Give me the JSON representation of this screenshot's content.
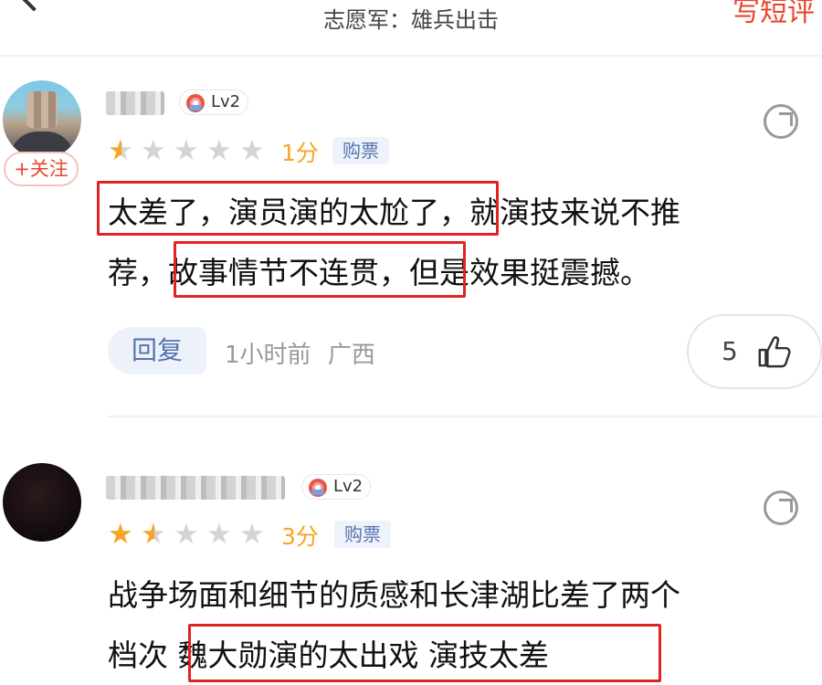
{
  "header": {
    "title": "志愿军：雄兵出击",
    "right_action": "写短评"
  },
  "comments": [
    {
      "level": "Lv2",
      "follow_label": "+关注",
      "score": "1分",
      "rating": 0.5,
      "max_rating": 5,
      "ticket_tag": "购票",
      "text_line1": "太差了，演员演的太尬了，就演技来说不推",
      "text_line2": "荐，故事情节不连贯，但是效果挺震撼。",
      "reply_label": "回复",
      "time": "1小时前",
      "location": "广西",
      "likes": "5",
      "highlights": [
        "太差了，演员演的太尬了",
        "故事情节不连贯，"
      ]
    },
    {
      "level": "Lv2",
      "score": "3分",
      "rating": 1.5,
      "max_rating": 5,
      "ticket_tag": "购票",
      "text_line1": "战争场面和细节的质感和长津湖比差了两个",
      "text_line2": "档次 魏大勋演的太出戏 演技太差",
      "highlights": [
        "魏大勋演的太出戏 演技太差"
      ]
    }
  ],
  "colors": {
    "accent": "#e8452c",
    "star": "#f5a623",
    "star_empty": "#d4d4d4",
    "tag_text": "#5573b0",
    "highlight_box": "#e02424"
  },
  "icons": [
    "back-arrow-icon",
    "share-icon",
    "thumbs-up-icon",
    "star-icon",
    "level-icon"
  ]
}
